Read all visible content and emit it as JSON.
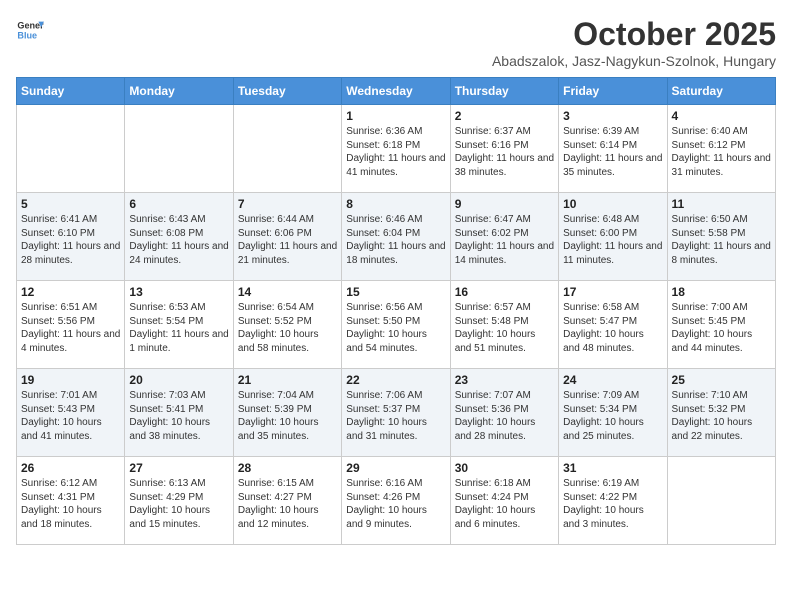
{
  "header": {
    "logo_general": "General",
    "logo_blue": "Blue",
    "month_title": "October 2025",
    "location": "Abadszalok, Jasz-Nagykun-Szolnok, Hungary"
  },
  "days_of_week": [
    "Sunday",
    "Monday",
    "Tuesday",
    "Wednesday",
    "Thursday",
    "Friday",
    "Saturday"
  ],
  "weeks": [
    [
      {
        "day": "",
        "info": ""
      },
      {
        "day": "",
        "info": ""
      },
      {
        "day": "",
        "info": ""
      },
      {
        "day": "1",
        "info": "Sunrise: 6:36 AM\nSunset: 6:18 PM\nDaylight: 11 hours and 41 minutes."
      },
      {
        "day": "2",
        "info": "Sunrise: 6:37 AM\nSunset: 6:16 PM\nDaylight: 11 hours and 38 minutes."
      },
      {
        "day": "3",
        "info": "Sunrise: 6:39 AM\nSunset: 6:14 PM\nDaylight: 11 hours and 35 minutes."
      },
      {
        "day": "4",
        "info": "Sunrise: 6:40 AM\nSunset: 6:12 PM\nDaylight: 11 hours and 31 minutes."
      }
    ],
    [
      {
        "day": "5",
        "info": "Sunrise: 6:41 AM\nSunset: 6:10 PM\nDaylight: 11 hours and 28 minutes."
      },
      {
        "day": "6",
        "info": "Sunrise: 6:43 AM\nSunset: 6:08 PM\nDaylight: 11 hours and 24 minutes."
      },
      {
        "day": "7",
        "info": "Sunrise: 6:44 AM\nSunset: 6:06 PM\nDaylight: 11 hours and 21 minutes."
      },
      {
        "day": "8",
        "info": "Sunrise: 6:46 AM\nSunset: 6:04 PM\nDaylight: 11 hours and 18 minutes."
      },
      {
        "day": "9",
        "info": "Sunrise: 6:47 AM\nSunset: 6:02 PM\nDaylight: 11 hours and 14 minutes."
      },
      {
        "day": "10",
        "info": "Sunrise: 6:48 AM\nSunset: 6:00 PM\nDaylight: 11 hours and 11 minutes."
      },
      {
        "day": "11",
        "info": "Sunrise: 6:50 AM\nSunset: 5:58 PM\nDaylight: 11 hours and 8 minutes."
      }
    ],
    [
      {
        "day": "12",
        "info": "Sunrise: 6:51 AM\nSunset: 5:56 PM\nDaylight: 11 hours and 4 minutes."
      },
      {
        "day": "13",
        "info": "Sunrise: 6:53 AM\nSunset: 5:54 PM\nDaylight: 11 hours and 1 minute."
      },
      {
        "day": "14",
        "info": "Sunrise: 6:54 AM\nSunset: 5:52 PM\nDaylight: 10 hours and 58 minutes."
      },
      {
        "day": "15",
        "info": "Sunrise: 6:56 AM\nSunset: 5:50 PM\nDaylight: 10 hours and 54 minutes."
      },
      {
        "day": "16",
        "info": "Sunrise: 6:57 AM\nSunset: 5:48 PM\nDaylight: 10 hours and 51 minutes."
      },
      {
        "day": "17",
        "info": "Sunrise: 6:58 AM\nSunset: 5:47 PM\nDaylight: 10 hours and 48 minutes."
      },
      {
        "day": "18",
        "info": "Sunrise: 7:00 AM\nSunset: 5:45 PM\nDaylight: 10 hours and 44 minutes."
      }
    ],
    [
      {
        "day": "19",
        "info": "Sunrise: 7:01 AM\nSunset: 5:43 PM\nDaylight: 10 hours and 41 minutes."
      },
      {
        "day": "20",
        "info": "Sunrise: 7:03 AM\nSunset: 5:41 PM\nDaylight: 10 hours and 38 minutes."
      },
      {
        "day": "21",
        "info": "Sunrise: 7:04 AM\nSunset: 5:39 PM\nDaylight: 10 hours and 35 minutes."
      },
      {
        "day": "22",
        "info": "Sunrise: 7:06 AM\nSunset: 5:37 PM\nDaylight: 10 hours and 31 minutes."
      },
      {
        "day": "23",
        "info": "Sunrise: 7:07 AM\nSunset: 5:36 PM\nDaylight: 10 hours and 28 minutes."
      },
      {
        "day": "24",
        "info": "Sunrise: 7:09 AM\nSunset: 5:34 PM\nDaylight: 10 hours and 25 minutes."
      },
      {
        "day": "25",
        "info": "Sunrise: 7:10 AM\nSunset: 5:32 PM\nDaylight: 10 hours and 22 minutes."
      }
    ],
    [
      {
        "day": "26",
        "info": "Sunrise: 6:12 AM\nSunset: 4:31 PM\nDaylight: 10 hours and 18 minutes."
      },
      {
        "day": "27",
        "info": "Sunrise: 6:13 AM\nSunset: 4:29 PM\nDaylight: 10 hours and 15 minutes."
      },
      {
        "day": "28",
        "info": "Sunrise: 6:15 AM\nSunset: 4:27 PM\nDaylight: 10 hours and 12 minutes."
      },
      {
        "day": "29",
        "info": "Sunrise: 6:16 AM\nSunset: 4:26 PM\nDaylight: 10 hours and 9 minutes."
      },
      {
        "day": "30",
        "info": "Sunrise: 6:18 AM\nSunset: 4:24 PM\nDaylight: 10 hours and 6 minutes."
      },
      {
        "day": "31",
        "info": "Sunrise: 6:19 AM\nSunset: 4:22 PM\nDaylight: 10 hours and 3 minutes."
      },
      {
        "day": "",
        "info": ""
      }
    ]
  ]
}
